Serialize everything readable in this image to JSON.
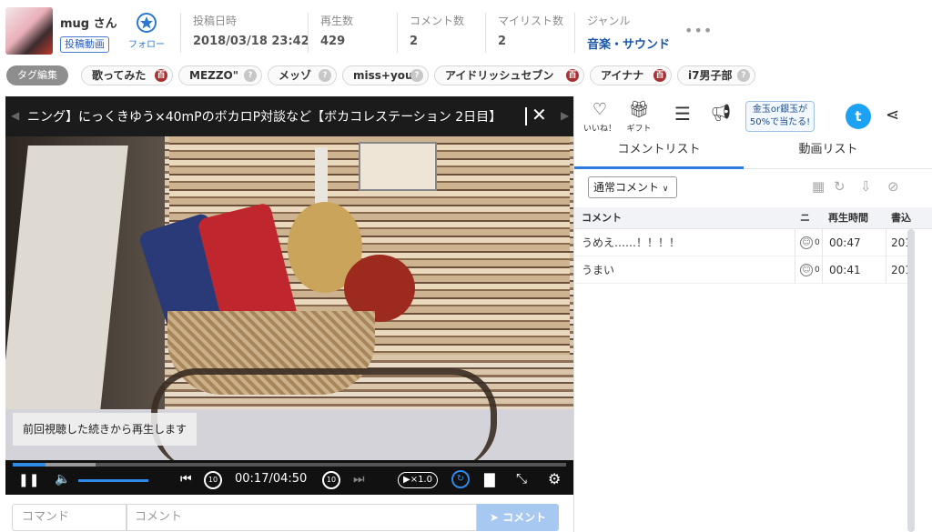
{
  "user": {
    "name": "mug さん",
    "post_badge": "投稿動画",
    "follow_label": "フォロー"
  },
  "stats": [
    {
      "key": "投稿日時",
      "value": "2018/03/18 23:42"
    },
    {
      "key": "再生数",
      "value": "429"
    },
    {
      "key": "コメント数",
      "value": "2"
    },
    {
      "key": "マイリスト数",
      "value": "2"
    },
    {
      "key": "ジャンル",
      "value": "音楽・サウンド"
    }
  ],
  "more_label": "•••",
  "tags": {
    "edit_label": "タグ編集",
    "items": [
      {
        "label": "歌ってみた",
        "badge": "lock",
        "badge_text": "百"
      },
      {
        "label": "MEZZO\"",
        "badge": "pedia",
        "badge_text": "?"
      },
      {
        "label": "メッゾ",
        "badge": "pedia",
        "badge_text": "?"
      },
      {
        "label": "miss+you",
        "badge": "pedia",
        "badge_text": "?"
      },
      {
        "label": "アイドリッシュセブン",
        "badge": "lock",
        "badge_text": "百"
      },
      {
        "label": "アイナナ",
        "badge": "lock",
        "badge_text": "百"
      },
      {
        "label": "i7男子部",
        "badge": "pedia",
        "badge_text": "?"
      }
    ]
  },
  "player": {
    "title": "ニング】にっくきゆう×40mPのボカロP対談など【ボカコレステーション 2日目】",
    "resume_toast": "前回視聴した続きから再生します",
    "current_time": "00:17",
    "duration": "04:50",
    "time_display": "00:17/04:50",
    "played_fraction": 0.059,
    "buffered_fraction": 0.15,
    "volume_fraction": 1.0,
    "playback_rate": "▶×1.0",
    "skip_seconds": "10"
  },
  "comment_input": {
    "command_placeholder": "コマンド",
    "comment_placeholder": "コメント",
    "send_label": "コメント"
  },
  "actions": {
    "like": "いいね！",
    "gift": "ギフト",
    "promo": "金玉or銀玉が50%で当たる!"
  },
  "panel": {
    "tabs": [
      "コメントリスト",
      "動画リスト"
    ],
    "filter_value": "通常コメント",
    "columns": [
      "コメント",
      "ニ",
      "再生時間",
      "書込"
    ],
    "rows": [
      {
        "comment": "うめえ……！！！！",
        "nicoru": "0",
        "time": "00:47",
        "posted": "201"
      },
      {
        "comment": "うまい",
        "nicoru": "0",
        "time": "00:41",
        "posted": "201"
      }
    ]
  },
  "colors": {
    "accent": "#2d7be0",
    "twitter": "#1da1f2",
    "lock_badge": "#a93232"
  }
}
